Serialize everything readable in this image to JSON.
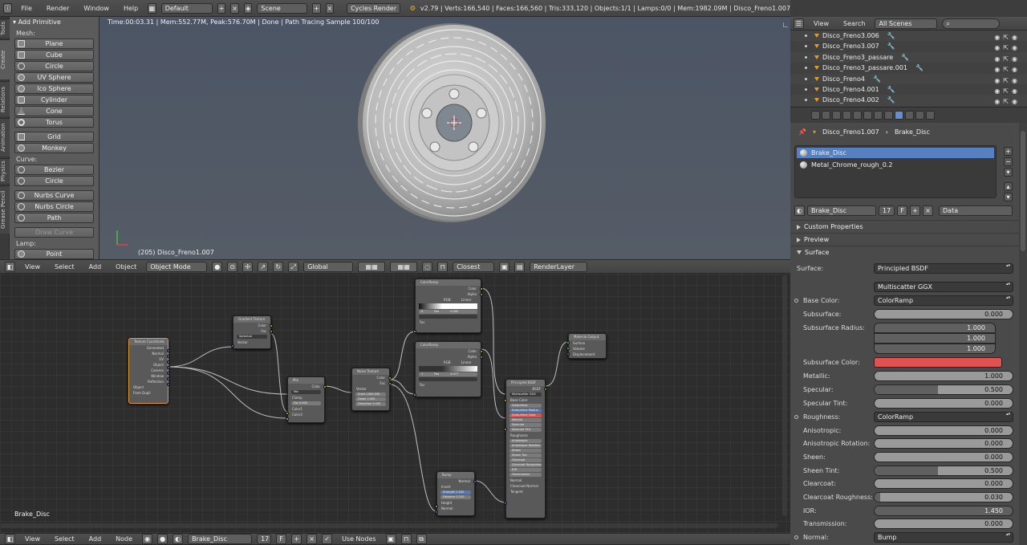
{
  "topbar": {
    "menus": [
      "File",
      "Render",
      "Window",
      "Help"
    ],
    "screen_layout": "Default",
    "scene": "Scene",
    "engine": "Cycles Render",
    "stats": "v2.79 | Verts:166,540 | Faces:166,560 | Tris:333,120 | Objects:1/1 | Lamps:0/0 | Mem:1982.09M | Disco_Freno1.007"
  },
  "tools": {
    "tabs": [
      "Tools",
      "Create",
      "Relations",
      "Animation",
      "Physics",
      "Grease Pencil"
    ],
    "panel_title": "Add Primitive",
    "mesh_label": "Mesh:",
    "mesh_items": [
      "Plane",
      "Cube",
      "Circle",
      "UV Sphere",
      "Ico Sphere",
      "Cylinder",
      "Cone",
      "Torus"
    ],
    "mesh_items2": [
      "Grid",
      "Monkey"
    ],
    "curve_label": "Curve:",
    "curve_items": [
      "Bezier",
      "Circle"
    ],
    "curve_items2": [
      "Nurbs Curve",
      "Nurbs Circle",
      "Path"
    ],
    "draw_curve": "Draw Curve",
    "lamp_label": "Lamp:",
    "lamp_items": [
      "Point"
    ]
  },
  "viewport": {
    "info": "Time:00:03.31 | Mem:552.77M, Peak:576.70M | Done | Path Tracing Sample 100/100",
    "object_label": "(205) Disco_Freno1.007"
  },
  "viewport_header": {
    "menus": [
      "View",
      "Select",
      "Add",
      "Object"
    ],
    "mode": "Object Mode",
    "orientation": "Global",
    "snap": "Closest",
    "render_layer": "RenderLayer"
  },
  "node_editor": {
    "material_label": "Brake_Disc",
    "nodes": {
      "texcoord": {
        "title": "Texture Coordinate",
        "outputs": [
          "Generated",
          "Normal",
          "UV",
          "Object",
          "Camera",
          "Window",
          "Reflection"
        ],
        "object_label": "Object",
        "from_dupli": "From Dupli"
      },
      "gradient": {
        "title": "Gradient Texture",
        "outputs": [
          "Color",
          "Fac"
        ],
        "type": "Spherical",
        "input": "Vector"
      },
      "mix": {
        "title": "Mix",
        "output": "Color",
        "blend": "Mix",
        "clamp": "Clamp",
        "fac_label": "Fac",
        "fac_value": "0.000",
        "inputs": [
          "Color1",
          "Color2"
        ]
      },
      "noise": {
        "title": "Noise Texture",
        "outputs": [
          "Color",
          "Fac"
        ],
        "input": "Vector",
        "scale_label": "Scale",
        "scale_value": "1000.000",
        "detail_label": "Detail",
        "detail_value": "2.000",
        "distortion_label": "Distortion",
        "distortion_value": "0.000"
      },
      "ramp1": {
        "title": "ColorRamp",
        "outputs": [
          "Color",
          "Alpha"
        ],
        "mode": "RGB",
        "interp": "Linear",
        "stop": "0",
        "pos_label": "Pos",
        "pos_value": "0.000",
        "input": "Fac"
      },
      "ramp2": {
        "title": "ColorRamp",
        "outputs": [
          "Color",
          "Alpha"
        ],
        "mode": "RGB",
        "interp": "Linear",
        "stop": "1",
        "pos_label": "Pos",
        "pos_value": "0.377",
        "input": "Fac"
      },
      "bump": {
        "title": "Bump",
        "output": "Normal",
        "invert": "Invert",
        "strength_label": "Strength",
        "strength_value": "0.040",
        "distance_label": "Distance",
        "distance_value": "0.100",
        "inputs": [
          "Height",
          "Normal"
        ]
      },
      "principled": {
        "title": "Principled BSDF",
        "output": "BSDF",
        "distribution": "Multiscatter GGX",
        "rows": [
          "Base Color",
          "Subsurface",
          "Subsurface Radius",
          "Subsurface Color",
          "Metallic",
          "Specular",
          "Specular Tint",
          "Roughness",
          "Anisotropic",
          "Anisotropic Rotation",
          "Sheen",
          "Sheen Tint",
          "Clearcoat",
          "Clearcoat Roughness",
          "IOR",
          "Transmission",
          "Normal",
          "Clearcoat Normal",
          "Tangent"
        ]
      },
      "output": {
        "title": "Material Output",
        "inputs": [
          "Surface",
          "Volume",
          "Displacement"
        ]
      }
    }
  },
  "node_header": {
    "menus": [
      "View",
      "Select",
      "Add",
      "Node"
    ],
    "material": "Brake_Disc",
    "users": "17",
    "fake": "F",
    "use_nodes": "Use Nodes"
  },
  "outliner": {
    "menus": [
      "View",
      "Search"
    ],
    "scene_filter": "All Scenes",
    "items": [
      "Disco_Freno3.006",
      "Disco_Freno3.007",
      "Disco_Freno3_passare",
      "Disco_Freno3_passare.001",
      "Disco_Freno4",
      "Disco_Freno4.001",
      "Disco_Freno4.002"
    ]
  },
  "properties": {
    "breadcrumb_object": "Disco_Freno1.007",
    "breadcrumb_material": "Brake_Disc",
    "materials": [
      "Brake_Disc",
      "Metal_Chrome_rough_0.2"
    ],
    "material_name": "Brake_Disc",
    "users": "17",
    "fake": "F",
    "link": "Data",
    "panels": [
      "Custom Properties",
      "Preview",
      "Surface"
    ],
    "surface_label": "Surface:",
    "surface_shader": "Principled BSDF",
    "distribution": "Multiscatter GGX",
    "base_color_label": "Base Color:",
    "base_color_value": "ColorRamp",
    "subsurface_label": "Subsurface:",
    "subsurface_value": "0.000",
    "subsurface_radius_label": "Subsurface Radius:",
    "subsurface_radius": [
      "1.000",
      "1.000",
      "1.000"
    ],
    "subsurface_color_label": "Subsurface Color:",
    "subsurface_color": "#e05252",
    "metallic_label": "Metallic:",
    "metallic_value": "1.000",
    "specular_label": "Specular:",
    "specular_value": "0.500",
    "specular_tint_label": "Specular Tint:",
    "specular_tint_value": "0.000",
    "roughness_label": "Roughness:",
    "roughness_value": "ColorRamp",
    "anisotropic_label": "Anisotropic:",
    "anisotropic_value": "0.000",
    "aniso_rot_label": "Anisotropic Rotation:",
    "aniso_rot_value": "0.000",
    "sheen_label": "Sheen:",
    "sheen_value": "0.000",
    "sheen_tint_label": "Sheen Tint:",
    "sheen_tint_value": "0.500",
    "clearcoat_label": "Clearcoat:",
    "clearcoat_value": "0.000",
    "clearcoat_rough_label": "Clearcoat Roughness:",
    "clearcoat_rough_value": "0.030",
    "ior_label": "IOR:",
    "ior_value": "1.450",
    "transmission_label": "Transmission:",
    "transmission_value": "0.000",
    "normal_label": "Normal:",
    "normal_value": "Bump"
  },
  "colors": {
    "selection_blue": "#5680c2",
    "node_select_orange": "#e49a2c",
    "subsurface_red": "#e05252"
  }
}
